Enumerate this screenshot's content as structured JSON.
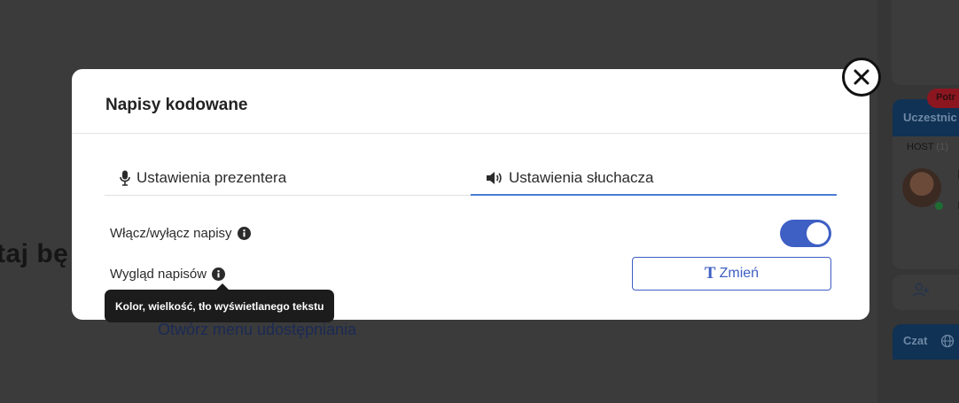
{
  "background": {
    "heading_fragment": "taj bę",
    "share_link": "Otwórz menu udostępniania",
    "right_panel": {
      "badge": "Potr",
      "participants_header": "Uczestnic",
      "host_label": "HOST",
      "host_count": "(1)",
      "chat_header": "Czat"
    }
  },
  "modal": {
    "title": "Napisy kodowane",
    "tabs": [
      {
        "label": "Ustawienia prezentera",
        "icon": "microphone-icon",
        "active": false
      },
      {
        "label": "Ustawienia słuchacza",
        "icon": "speaker-icon",
        "active": true
      }
    ],
    "toggle_row": {
      "label": "Włącz/wyłącz napisy",
      "state": "on"
    },
    "appearance_row": {
      "label": "Wygląd napisów",
      "button_label": "Zmień",
      "button_icon": "T"
    },
    "tooltip": "Kolor, wielkość, tło wyświetlanego tekstu"
  },
  "colors": {
    "accent": "#3e5fc4",
    "tab_underline": "#4a7ed4",
    "overlay": "#3b3b3b",
    "tooltip_bg": "#1c1c1c"
  }
}
